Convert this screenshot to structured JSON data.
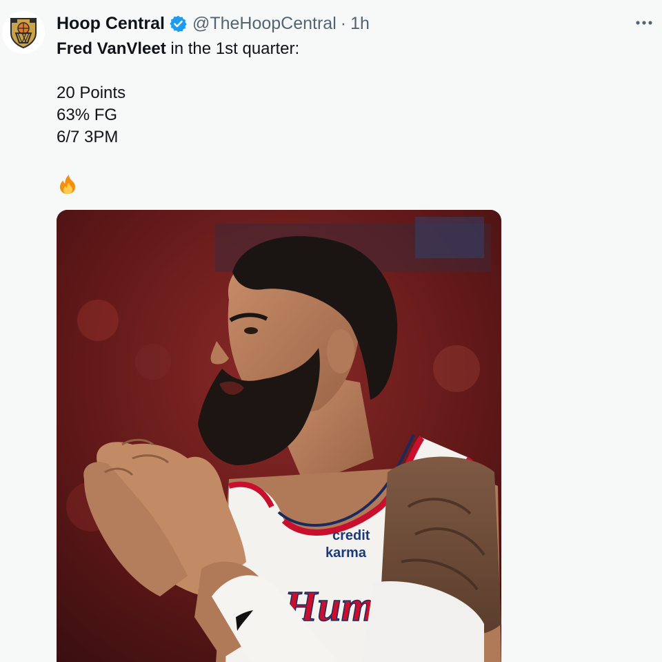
{
  "author": {
    "display_name": "Hoop Central",
    "handle": "@TheHoopCentral",
    "separator": "·",
    "time": "1h",
    "verified": true,
    "avatar_icon": "hoop-central-logo-icon"
  },
  "tweet": {
    "line1_bold": "Fred VanVleet",
    "line1_rest": " in the 1st quarter:",
    "stats": [
      "20 Points",
      "63% FG",
      "6/7 3PM"
    ],
    "emoji": "fire-emoji-icon"
  },
  "media": {
    "jersey_sponsor_line1": "credit",
    "jersey_sponsor_line2": "karma",
    "jersey_wordmark": "Hum"
  },
  "colors": {
    "background": "#f7f9f9",
    "verified_blue": "#1d9bf0",
    "secondary_text": "#536471",
    "jersey_red": "#c8102e"
  }
}
